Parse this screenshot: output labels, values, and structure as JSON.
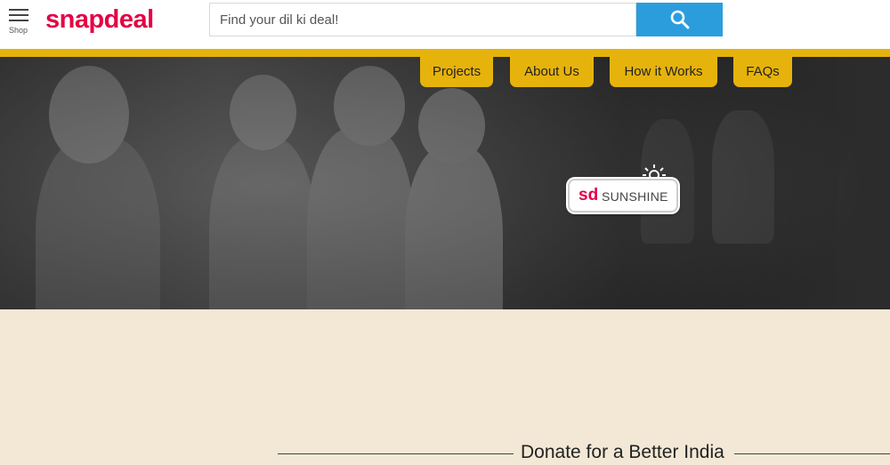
{
  "header": {
    "menu_label": "Shop",
    "logo_text": "snapdeal",
    "search": {
      "placeholder": "Find your dil ki deal!"
    }
  },
  "nav": {
    "tabs": [
      {
        "label": "Projects"
      },
      {
        "label": "About Us"
      },
      {
        "label": "How it Works"
      },
      {
        "label": "FAQs"
      }
    ]
  },
  "badge": {
    "logo": "sd",
    "name": "SUNSHINE"
  },
  "main": {
    "heading": "Donate for a Better India"
  },
  "colors": {
    "brand": "#e40046",
    "accent_yellow": "#e6b30c",
    "search_button": "#2b9ddd",
    "paper": "#f2e8d5"
  },
  "icons": {
    "search_button": "search-icon",
    "menu": "hamburger-icon",
    "badge_sun": "sun-icon"
  }
}
